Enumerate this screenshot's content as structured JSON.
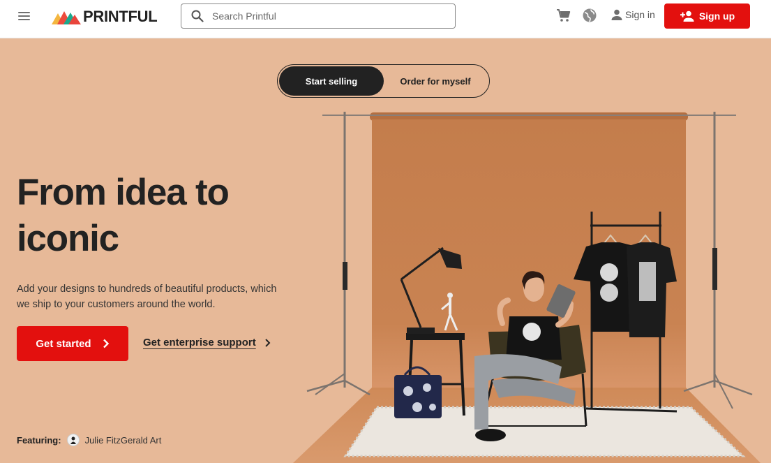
{
  "header": {
    "logo_text": "PRINTFUL",
    "search_placeholder": "Search Printful",
    "cart_icon": "cart-icon",
    "language_icon": "globe-icon",
    "sign_in_label": "Sign in",
    "sign_up_label": "Sign up"
  },
  "hero": {
    "toggle": {
      "active_label": "Start selling",
      "inactive_label": "Order for myself"
    },
    "title_line1": "From idea to",
    "title_line2": "iconic",
    "description": "Add your designs to hundreds of beautiful products, which we ship to your customers around the world.",
    "cta_primary": "Get started",
    "cta_secondary": "Get enterprise support",
    "featuring_label": "Featuring:",
    "featuring_name": "Julie FitzGerald Art"
  },
  "colors": {
    "brand_red": "#e3100e",
    "hero_background": "#e7b998",
    "backdrop_paper": "#c57e4f",
    "text_dark": "#222222"
  }
}
